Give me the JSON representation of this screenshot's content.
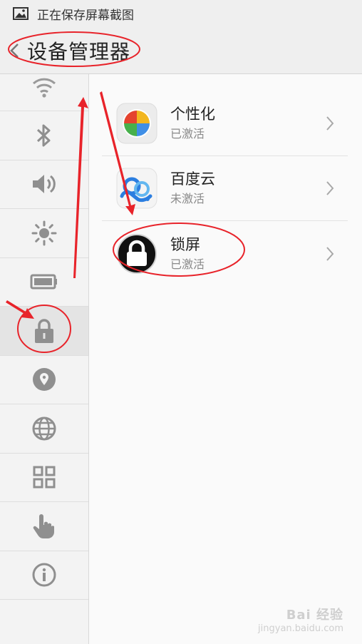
{
  "statusbar": {
    "text": "正在保存屏幕截图",
    "icon": "image-icon"
  },
  "header": {
    "title": "设备管理器",
    "back_icon": "back-icon"
  },
  "sidebar": {
    "items": [
      {
        "icon": "wifi-icon"
      },
      {
        "icon": "bluetooth-icon"
      },
      {
        "icon": "volume-icon"
      },
      {
        "icon": "brightness-icon"
      },
      {
        "icon": "battery-icon"
      },
      {
        "icon": "lock-icon",
        "active": true
      },
      {
        "icon": "location-icon"
      },
      {
        "icon": "globe-icon"
      },
      {
        "icon": "apps-grid-icon"
      },
      {
        "icon": "hand-pointer-icon"
      },
      {
        "icon": "info-icon"
      }
    ]
  },
  "device_admins": [
    {
      "name": "个性化",
      "status": "已激活",
      "icon": "personalization-app-icon"
    },
    {
      "name": "百度云",
      "status": "未激活",
      "icon": "baidu-cloud-app-icon"
    },
    {
      "name": "锁屏",
      "status": "已激活",
      "icon": "lockscreen-app-icon"
    }
  ],
  "watermark": {
    "brand": "Bai 经验",
    "url": "jingyan.baidu.com"
  },
  "annotation_color": "#e8232a"
}
